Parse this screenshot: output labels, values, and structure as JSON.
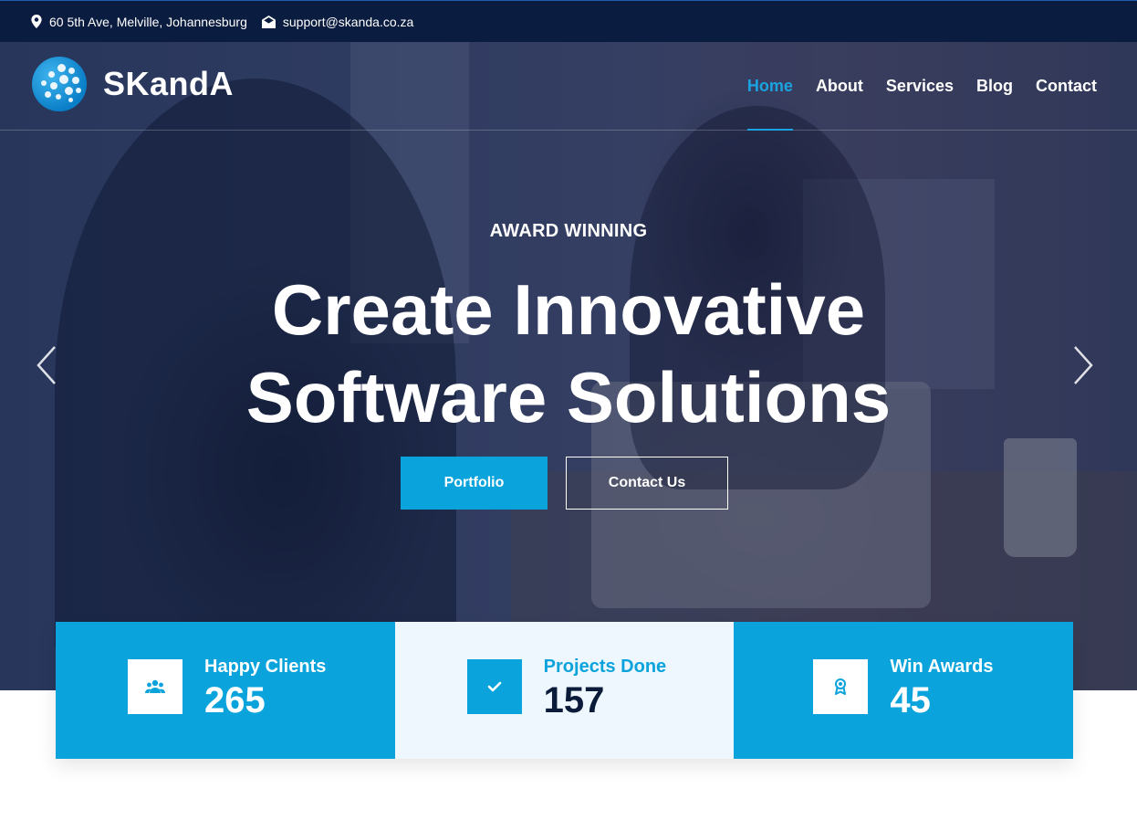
{
  "topbar": {
    "address": "60 5th Ave, Melville, Johannesburg",
    "email": "support@skanda.co.za"
  },
  "brand": {
    "name": "SKandA",
    "accent_color": "#0aa3dc",
    "dark_color": "#0a1c3f"
  },
  "nav": {
    "items": [
      {
        "label": "Home",
        "active": true
      },
      {
        "label": "About",
        "active": false
      },
      {
        "label": "Services",
        "active": false
      },
      {
        "label": "Blog",
        "active": false
      },
      {
        "label": "Contact",
        "active": false
      }
    ]
  },
  "hero": {
    "subtitle": "AWARD WINNING",
    "headline_line1": "Create Innovative",
    "headline_line2": "Software Solutions",
    "primary_button": "Portfolio",
    "secondary_button": "Contact Us",
    "prev_icon": "chevron-left-icon",
    "next_icon": "chevron-right-icon"
  },
  "stats": [
    {
      "label": "Happy Clients",
      "value": "265",
      "icon": "users-icon"
    },
    {
      "label": "Projects Done",
      "value": "157",
      "icon": "check-icon"
    },
    {
      "label": "Win Awards",
      "value": "45",
      "icon": "award-icon"
    }
  ]
}
